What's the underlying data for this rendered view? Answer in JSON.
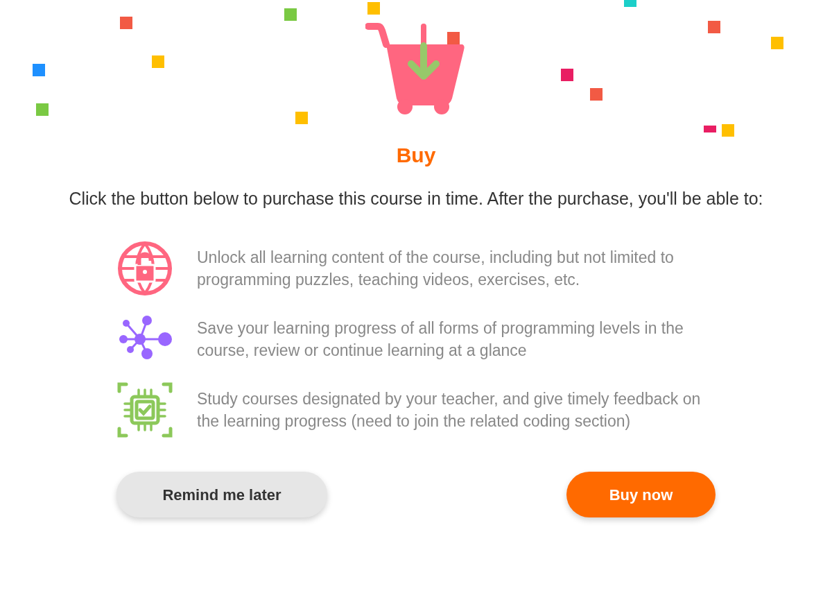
{
  "title": "Buy",
  "description": "Click the button below to purchase this course in time. After the purchase, you'll be able to:",
  "features": [
    {
      "kind": "unlock",
      "text": "Unlock all learning content of the course, including but not limited to programming puzzles, teaching videos, exercises, etc."
    },
    {
      "kind": "network",
      "text": "Save your learning progress of all forms of programming levels in the course, review or continue learning at a glance"
    },
    {
      "kind": "chip",
      "text": "Study courses designated by your teacher, and give timely feedback on the learning progress (need to join the related coding section)"
    }
  ],
  "buttons": [
    {
      "kind": "secondary",
      "label": "Remind me later"
    },
    {
      "kind": "primary",
      "label": "Buy now"
    }
  ]
}
